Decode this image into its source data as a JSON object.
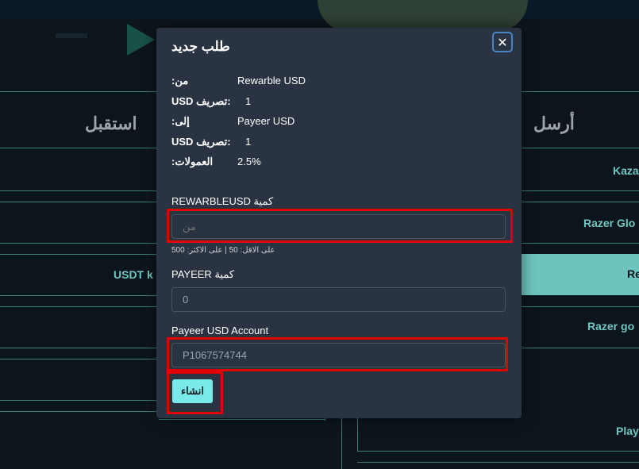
{
  "background": {
    "receive_heading": "استقبل",
    "send_heading": "أرسل",
    "left_rows": [
      "USDT k"
    ],
    "right_rows": [
      "Kaza",
      "Razer Glo",
      "Re",
      "Razer go",
      "Play"
    ]
  },
  "modal": {
    "title": "طلب جديد",
    "close_symbol": "✕",
    "info": [
      {
        "label": ":من",
        "value": "Rewarble USD"
      },
      {
        "label": "USD تصريف:",
        "value": "1"
      },
      {
        "label": ":إلى",
        "value": "Payeer USD"
      },
      {
        "label": "USD تصريف:",
        "value": "1"
      },
      {
        "label": ":العمولات",
        "value": "2.5%"
      }
    ],
    "amount_from_label": "REWARBLEUSD كمية",
    "amount_from_placeholder": "من",
    "amount_hint": "على الاقل: 50 | على الاكثر: 500",
    "amount_to_label": "PAYEER كمية",
    "amount_to_value": "0",
    "account_label": "Payeer USD Account",
    "account_value": "P1067574744",
    "submit_label": "انشاء"
  },
  "colors": {
    "modal_bg": "#2a3341",
    "accent": "#7ae9ea",
    "highlight": "#e10000",
    "teal_row": "#6dc4be"
  }
}
